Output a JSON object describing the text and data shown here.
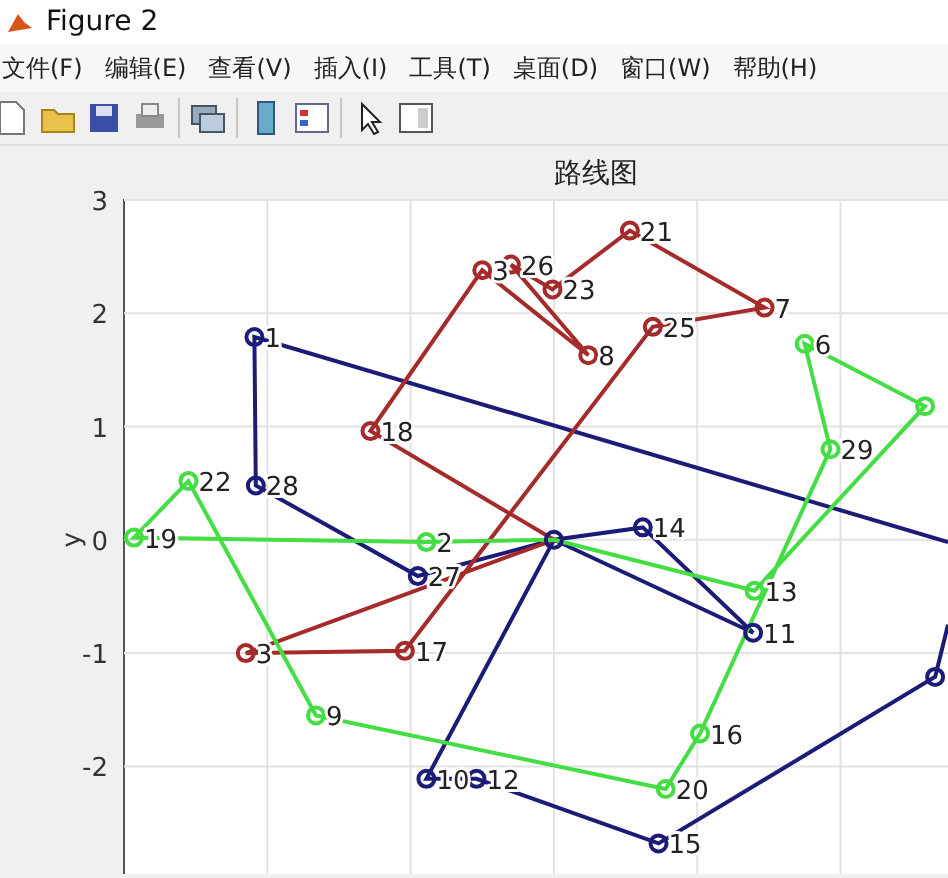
{
  "window": {
    "title": "Figure 2"
  },
  "menu": [
    "文件(F)",
    "编辑(E)",
    "查看(V)",
    "插入(I)",
    "工具(T)",
    "桌面(D)",
    "窗口(W)",
    "帮助(H)"
  ],
  "toolbar": [
    {
      "kind": "new"
    },
    {
      "kind": "open"
    },
    {
      "kind": "save"
    },
    {
      "kind": "print"
    },
    {
      "kind": "separator"
    },
    {
      "kind": "link"
    },
    {
      "kind": "separator"
    },
    {
      "kind": "colorbar"
    },
    {
      "kind": "legend"
    },
    {
      "kind": "separator"
    },
    {
      "kind": "pointer"
    },
    {
      "kind": "panel"
    }
  ],
  "axes": {
    "title": "路线图",
    "ylabel": "y",
    "yticks": [
      "3",
      "2",
      "1",
      "0",
      "-1",
      "-2"
    ]
  },
  "routes": [
    {
      "color": "#1c1c78",
      "stops": [
        "1",
        "28",
        "27",
        "14",
        "11",
        "10",
        "12",
        "15"
      ]
    },
    {
      "color": "#a52a2a",
      "stops": [
        "18",
        "3",
        "8",
        "26",
        "23",
        "21",
        "7",
        "25",
        "17",
        "3"
      ]
    },
    {
      "color": "#44dd44",
      "stops": [
        "2",
        "19",
        "22",
        "9",
        "20",
        "16",
        "29",
        "6",
        "13"
      ]
    }
  ]
}
